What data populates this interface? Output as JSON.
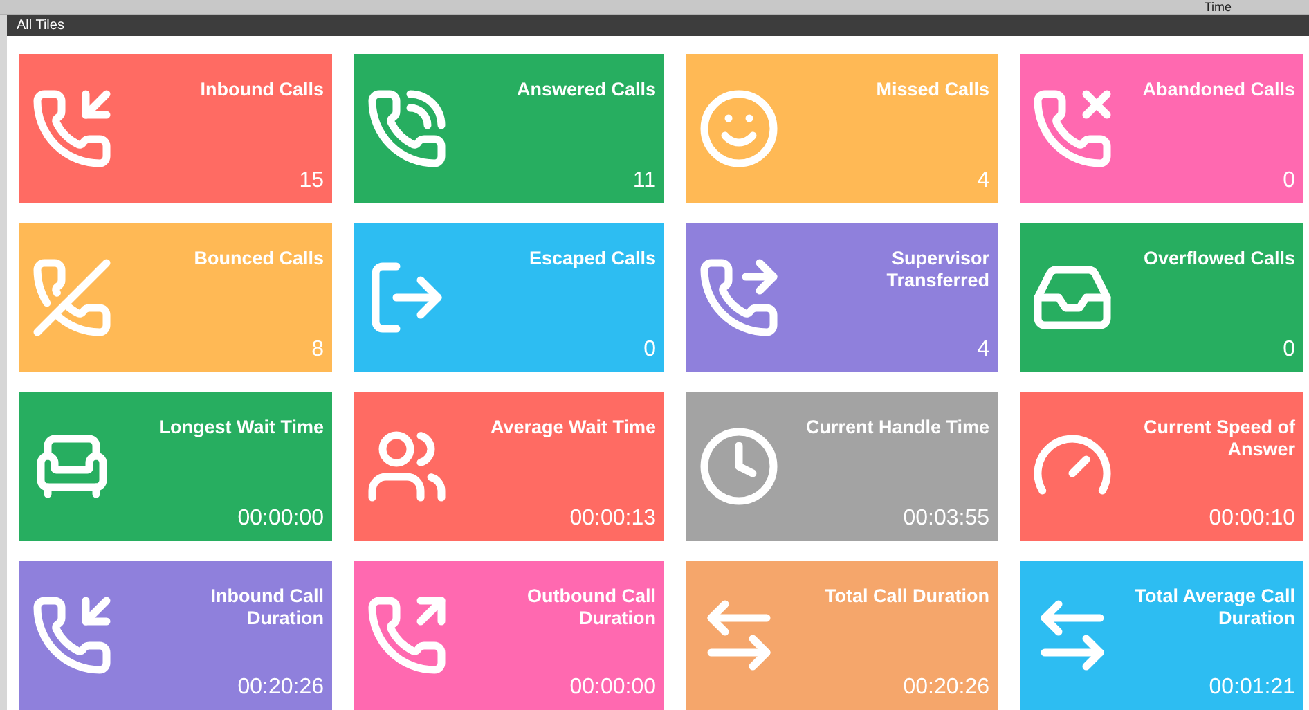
{
  "background_header": {
    "column_label": "Time"
  },
  "window": {
    "title": "All Tiles"
  },
  "tiles": [
    {
      "title": "Inbound Calls",
      "value": "15",
      "color": "#ff6b63"
    },
    {
      "title": "Answered Calls",
      "value": "11",
      "color": "#27ae60"
    },
    {
      "title": "Missed Calls",
      "value": "4",
      "color": "#ffb955"
    },
    {
      "title": "Abandoned Calls",
      "value": "0",
      "color": "#ff69b0"
    },
    {
      "title": "Bounced Calls",
      "value": "8",
      "color": "#ffb955"
    },
    {
      "title": "Escaped Calls",
      "value": "0",
      "color": "#2dbdf2"
    },
    {
      "title": "Supervisor Transferred",
      "value": "4",
      "color": "#8f80dc"
    },
    {
      "title": "Overflowed Calls",
      "value": "0",
      "color": "#27ae60"
    },
    {
      "title": "Longest Wait Time",
      "value": "00:00:00",
      "color": "#27ae60"
    },
    {
      "title": "Average Wait Time",
      "value": "00:00:13",
      "color": "#ff6b63"
    },
    {
      "title": "Current Handle Time",
      "value": "00:03:55",
      "color": "#a3a3a3"
    },
    {
      "title": "Current Speed of Answer",
      "value": "00:00:10",
      "color": "#ff6b63"
    },
    {
      "title": "Inbound Call Duration",
      "value": "00:20:26",
      "color": "#8f80dc"
    },
    {
      "title": "Outbound Call Duration",
      "value": "00:00:00",
      "color": "#ff69b0"
    },
    {
      "title": "Total Call Duration",
      "value": "00:20:26",
      "color": "#f5a66b"
    },
    {
      "title": "Total Average Call Duration",
      "value": "00:01:21",
      "color": "#2dbdf2"
    }
  ]
}
